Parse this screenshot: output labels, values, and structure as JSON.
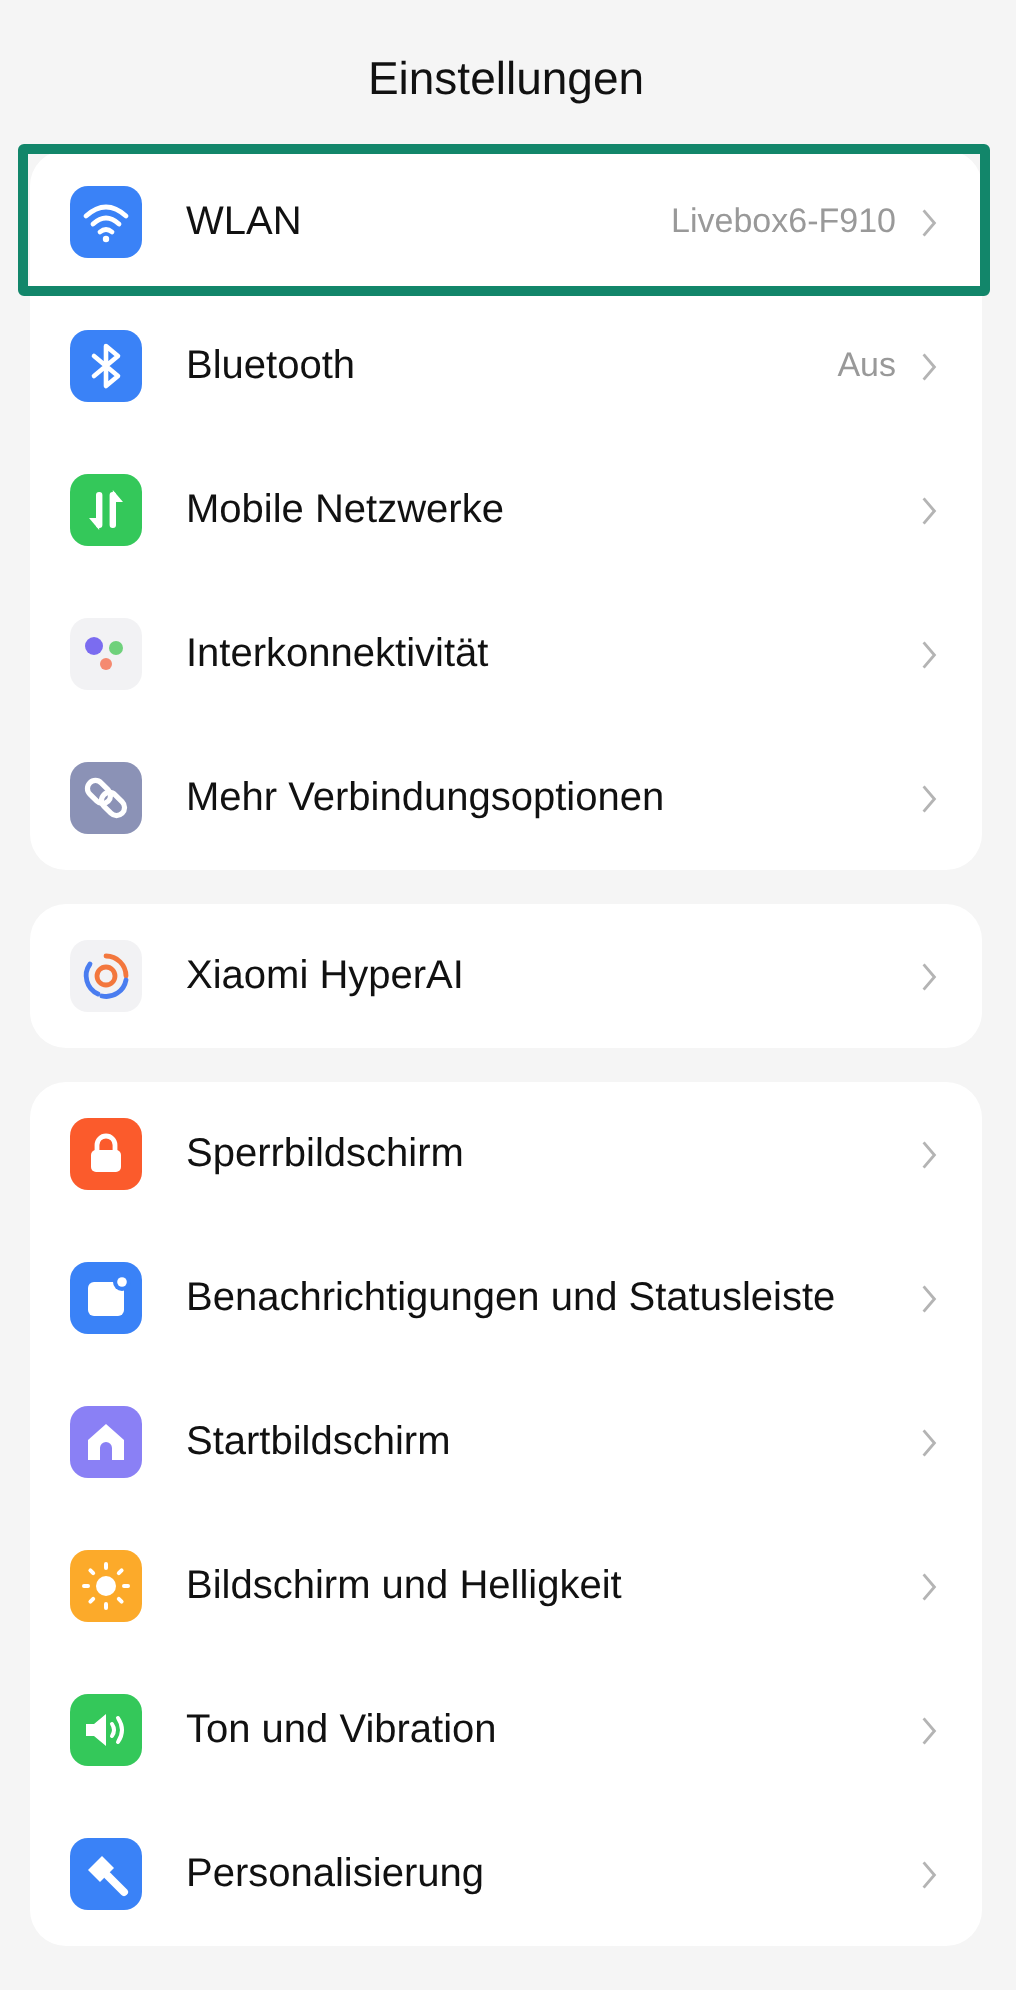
{
  "title": "Einstellungen",
  "groups": [
    {
      "items": [
        {
          "kind": "wifi",
          "label": "WLAN",
          "value": "Livebox6-F910",
          "highlighted": true
        },
        {
          "kind": "bluetooth",
          "label": "Bluetooth",
          "value": "Aus",
          "highlighted": false
        },
        {
          "kind": "mobile",
          "label": "Mobile Netzwerke",
          "highlighted": false
        },
        {
          "kind": "connect",
          "label": "Interkonnektivität",
          "highlighted": false
        },
        {
          "kind": "link",
          "label": "Mehr Verbindungsoptionen",
          "highlighted": false
        }
      ]
    },
    {
      "items": [
        {
          "kind": "ai",
          "label": "Xiaomi HyperAI",
          "highlighted": false
        }
      ]
    },
    {
      "items": [
        {
          "kind": "lock",
          "label": "Sperrbildschirm",
          "highlighted": false
        },
        {
          "kind": "notify",
          "label": "Benachrichtigungen und Statusleiste",
          "highlighted": false
        },
        {
          "kind": "home",
          "label": "Startbildschirm",
          "highlighted": false
        },
        {
          "kind": "sun",
          "label": "Bildschirm und Helligkeit",
          "highlighted": false
        },
        {
          "kind": "sound",
          "label": "Ton und Vibration",
          "highlighted": false
        },
        {
          "kind": "brush",
          "label": "Personalisierung",
          "highlighted": false
        }
      ]
    }
  ]
}
